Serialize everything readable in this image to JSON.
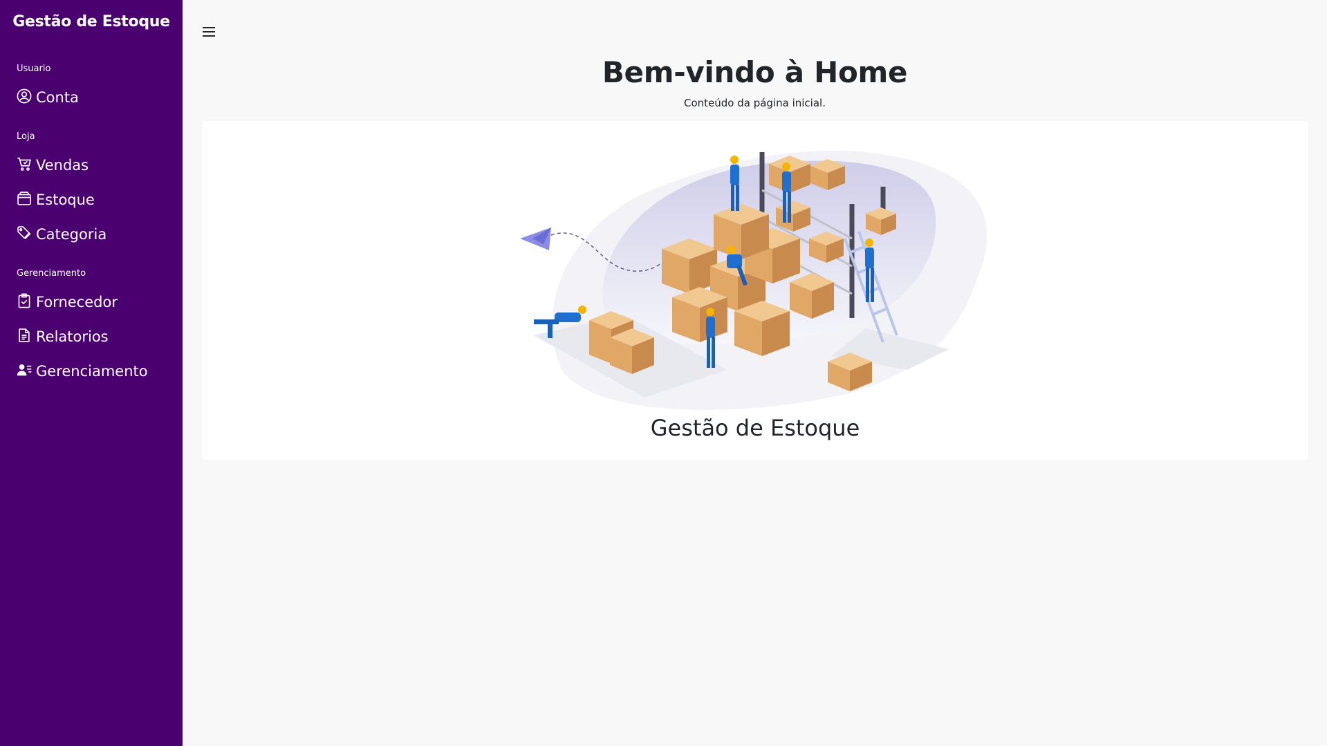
{
  "sidebar": {
    "brand": "Gestão de Estoque",
    "sections": {
      "usuario": "Usuario",
      "loja": "Loja",
      "gerenciamento": "Gerenciamento"
    },
    "items": {
      "conta": "Conta",
      "vendas": "Vendas",
      "estoque": "Estoque",
      "categoria": "Categoria",
      "fornecedor": "Fornecedor",
      "relatorios": "Relatorios",
      "gerenciamento": "Gerenciamento"
    }
  },
  "header": {
    "menu_icon": "hamburger-icon"
  },
  "main": {
    "title": "Bem-vindo à Home",
    "subtitle": "Conteúdo da página inicial.",
    "card_caption": "Gestão de Estoque"
  },
  "colors": {
    "sidebar_bg": "#4b0070",
    "page_bg": "#f8f8f8",
    "card_bg": "#ffffff"
  }
}
